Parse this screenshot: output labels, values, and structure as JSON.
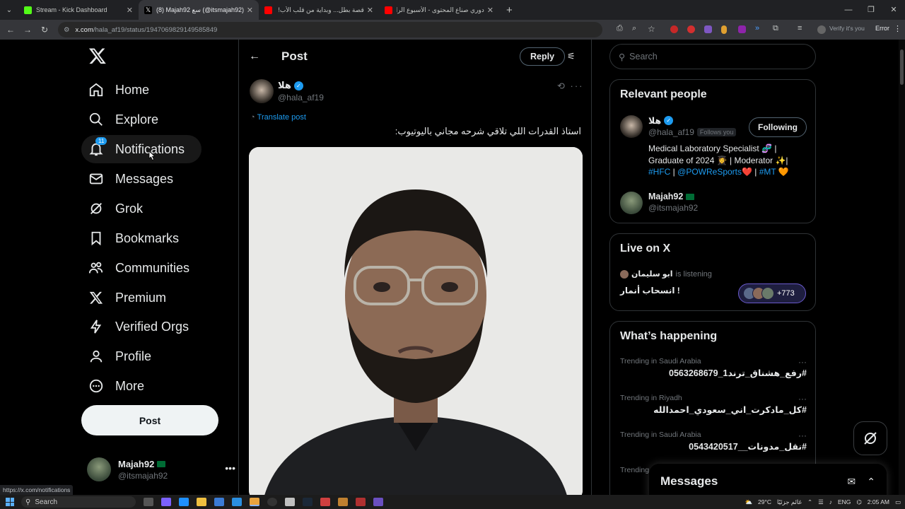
{
  "browser": {
    "tabs": [
      {
        "title": "Stream - Kick Dashboard",
        "favicon_color": "#53fc18",
        "active": false
      },
      {
        "title": "(8) Majah92 سع (@itsmajah92) /",
        "favicon_color": "#ffffff",
        "active": true
      },
      {
        "title": "قصة بطل... وبداية من قلب الأب!",
        "favicon_color": "#ff0000",
        "active": false
      },
      {
        "title": "دوري صناع المحتوى - الأسبوع الرا",
        "favicon_color": "#ff0000",
        "active": false
      }
    ],
    "url_host": "x.com",
    "url_path": "/hala_af19/status/1947069829149585849",
    "verify_label": "Verify it's you",
    "error_label": "Error",
    "status_url": "https://x.com/notifications"
  },
  "sidebar": {
    "items": [
      {
        "label": "Home",
        "icon": "home-icon"
      },
      {
        "label": "Explore",
        "icon": "search-icon"
      },
      {
        "label": "Notifications",
        "icon": "bell-icon",
        "badge": "11"
      },
      {
        "label": "Messages",
        "icon": "envelope-icon"
      },
      {
        "label": "Grok",
        "icon": "grok-icon"
      },
      {
        "label": "Bookmarks",
        "icon": "bookmark-icon"
      },
      {
        "label": "Communities",
        "icon": "people-icon"
      },
      {
        "label": "Premium",
        "icon": "x-logo-icon"
      },
      {
        "label": "Verified Orgs",
        "icon": "lightning-icon"
      },
      {
        "label": "Profile",
        "icon": "person-icon"
      },
      {
        "label": "More",
        "icon": "more-circle-icon"
      }
    ],
    "post_label": "Post",
    "account": {
      "name": "Majah92",
      "handle": "@itsmajah92"
    }
  },
  "main": {
    "title": "Post",
    "reply_label": "Reply",
    "tweet": {
      "author_name": "هلا",
      "author_handle": "@hala_af19",
      "translate_label": "Translate post",
      "text": "استاذ القدرات اللي تلاقي شرحه مجاني باليوتيوب:"
    }
  },
  "right": {
    "search_placeholder": "Search",
    "relevant": {
      "title": "Relevant people",
      "person1": {
        "name": "هلا",
        "handle": "@hala_af19",
        "follows_you": "Follows you",
        "button": "Following",
        "bio_line1": "Medical Laboratory Specialist 🧬 |",
        "bio_line2": "Graduate of 2024 👩‍🎓 | Moderator ✨|",
        "bio_tags": [
          "#HFC",
          "@POWReSports",
          "#MT"
        ]
      },
      "person2": {
        "name": "Majah92",
        "handle": "@itsmajah92"
      }
    },
    "live": {
      "title": "Live on X",
      "host": "ابو سليمان",
      "listening_text": "is listening",
      "space_title": "انسحاب أنمار !",
      "listeners": "+773"
    },
    "happening": {
      "title": "What’s happening",
      "trends": [
        {
          "context": "Trending in Saudi Arabia",
          "tag": "#رفع_هشناق_ترند1_0563268679"
        },
        {
          "context": "Trending in Riyadh",
          "tag": "#كل_مادكرت_اني_سعودي_احمدالله"
        },
        {
          "context": "Trending in Saudi Arabia",
          "tag": "#نقل_مدونات__0543420517"
        },
        {
          "context": "Trending",
          "tag": ""
        }
      ]
    }
  },
  "messages_drawer": {
    "title": "Messages"
  },
  "taskbar": {
    "search_label": "Search",
    "weather": "29°C",
    "weather_text": "غائم جزئيًا",
    "lang": "ENG",
    "time": "2:05 AM"
  }
}
